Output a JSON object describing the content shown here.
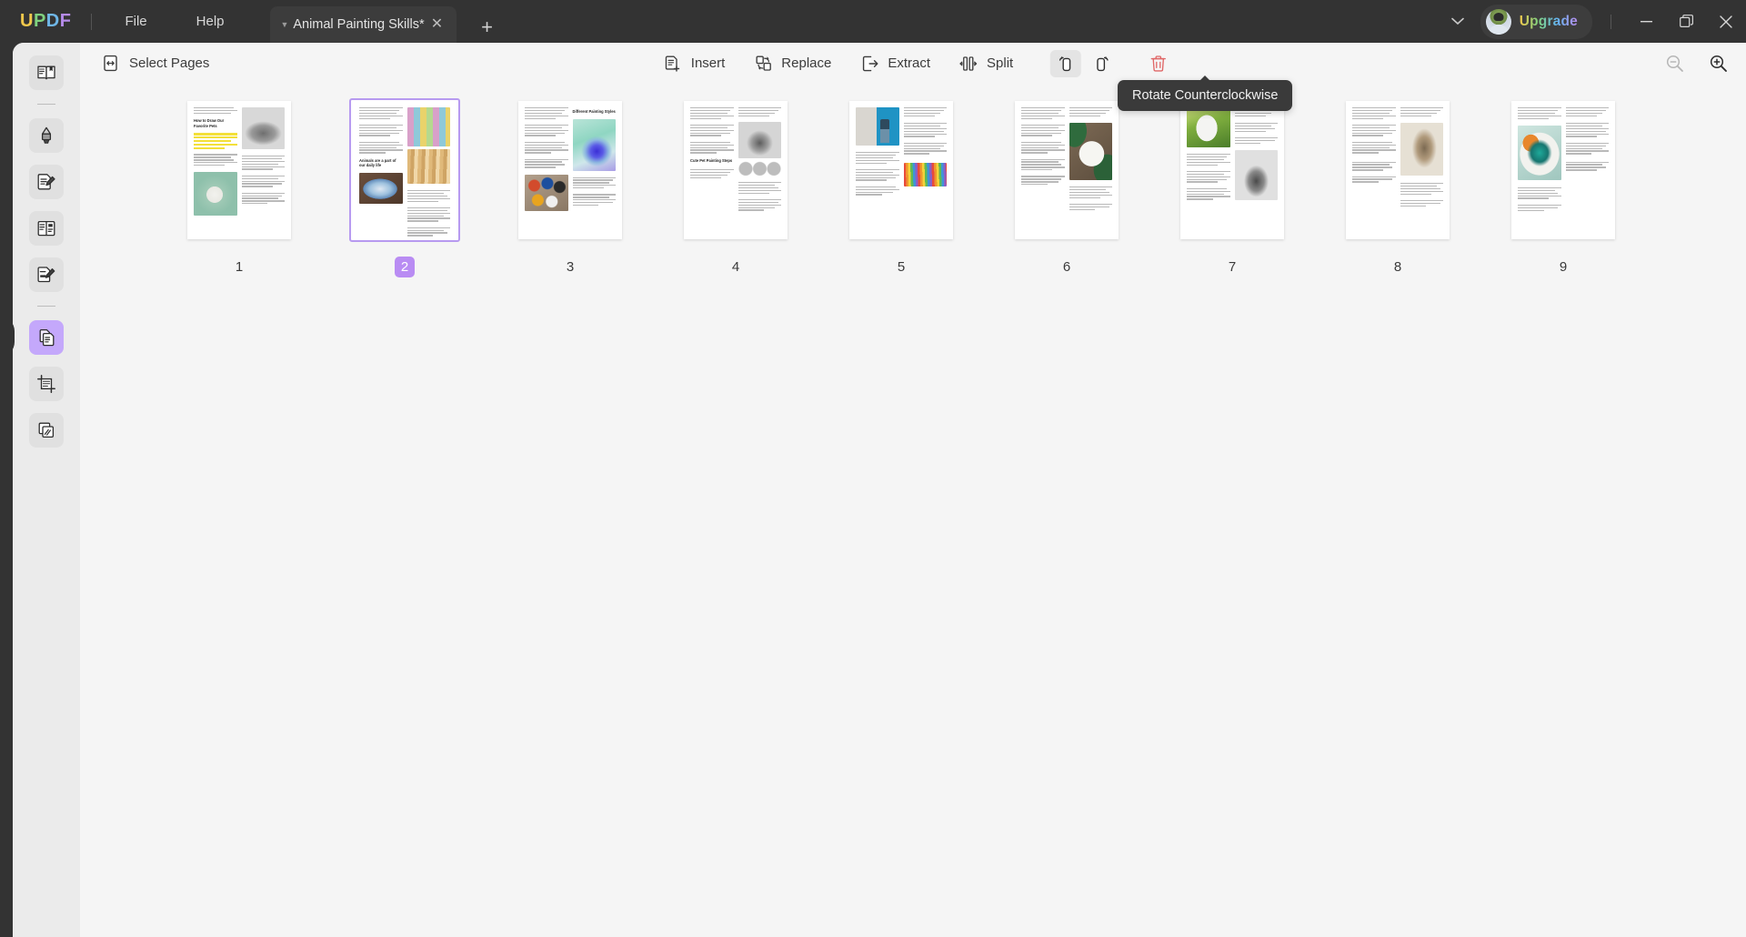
{
  "app": {
    "logo_letters": [
      "U",
      "P",
      "D",
      "F"
    ],
    "menus": [
      {
        "name": "file",
        "label": "File"
      },
      {
        "name": "help",
        "label": "Help"
      }
    ],
    "tab": {
      "title": "Animal Painting Skills*",
      "caret_icon": "chevron-down-icon",
      "close_icon": "close-icon"
    },
    "new_tab_label": "+",
    "upgrade_label": "Upgrade",
    "window_controls": {
      "minimize": "—",
      "maximize": "❐",
      "close": "✕"
    },
    "colors": {
      "titlebar_bg": "#333333",
      "tab_bg": "#3c3c3c",
      "rail_bg": "#ebebeb",
      "canvas_bg": "#f5f5f5",
      "accent_purple": "#b98cf3",
      "selection_border": "#b79af0",
      "delete_red": "#e06666",
      "logo_u": "#F2C94C",
      "logo_p": "#7FD17F",
      "logo_d": "#6FB7E8",
      "logo_f": "#B68BEA"
    }
  },
  "sidebar": {
    "items": [
      {
        "name": "reader",
        "icon": "book-reader-icon",
        "active": false
      },
      {
        "name": "annotate-highlight",
        "icon": "highlighter-pen-icon",
        "active": false
      },
      {
        "name": "edit-pdf",
        "icon": "edit-document-icon",
        "active": false
      },
      {
        "name": "page-layout",
        "icon": "split-view-icon",
        "active": false
      },
      {
        "name": "fill-and-sign",
        "icon": "sign-document-icon",
        "active": false
      },
      {
        "name": "organize-pages",
        "icon": "organize-pages-icon",
        "active": true
      },
      {
        "name": "crop-pages",
        "icon": "crop-icon",
        "active": false
      },
      {
        "name": "batch-process",
        "icon": "stacked-pages-icon",
        "active": false
      }
    ]
  },
  "toolbar": {
    "select_pages": {
      "label": "Select Pages",
      "icon": "select-pages-icon"
    },
    "actions": [
      {
        "name": "insert",
        "label": "Insert",
        "icon": "insert-page-icon"
      },
      {
        "name": "replace",
        "label": "Replace",
        "icon": "replace-page-icon"
      },
      {
        "name": "extract",
        "label": "Extract",
        "icon": "extract-page-icon"
      },
      {
        "name": "split",
        "label": "Split",
        "icon": "split-page-icon"
      }
    ],
    "rotate_ccw": {
      "name": "rotate-counterclockwise",
      "icon": "rotate-ccw-icon",
      "hovered": true
    },
    "rotate_cw": {
      "name": "rotate-clockwise",
      "icon": "rotate-cw-icon"
    },
    "delete": {
      "name": "delete-pages",
      "icon": "trash-icon"
    },
    "zoom_out": {
      "name": "zoom-out",
      "icon": "magnifier-minus-icon",
      "disabled": true
    },
    "zoom_in": {
      "name": "zoom-in",
      "icon": "magnifier-plus-icon",
      "disabled": false
    }
  },
  "tooltip": {
    "text": "Rotate Counterclockwise",
    "visible": true
  },
  "pages": [
    {
      "number": "1",
      "selected": false,
      "heading": "How to Draw Our Favorite Pets",
      "has_highlight": true
    },
    {
      "number": "2",
      "selected": true,
      "heading": "Animals are a part of our daily life",
      "has_highlight": false
    },
    {
      "number": "3",
      "selected": false,
      "heading": "Different Painting Styles",
      "has_highlight": false
    },
    {
      "number": "4",
      "selected": false,
      "heading": "Cute Pet Painting Steps",
      "has_highlight": false
    },
    {
      "number": "5",
      "selected": false,
      "heading": "",
      "has_highlight": false
    },
    {
      "number": "6",
      "selected": false,
      "heading": "",
      "has_highlight": false
    },
    {
      "number": "7",
      "selected": false,
      "heading": "",
      "has_highlight": false
    },
    {
      "number": "8",
      "selected": false,
      "heading": "",
      "has_highlight": false
    },
    {
      "number": "9",
      "selected": false,
      "heading": "",
      "has_highlight": false
    }
  ]
}
